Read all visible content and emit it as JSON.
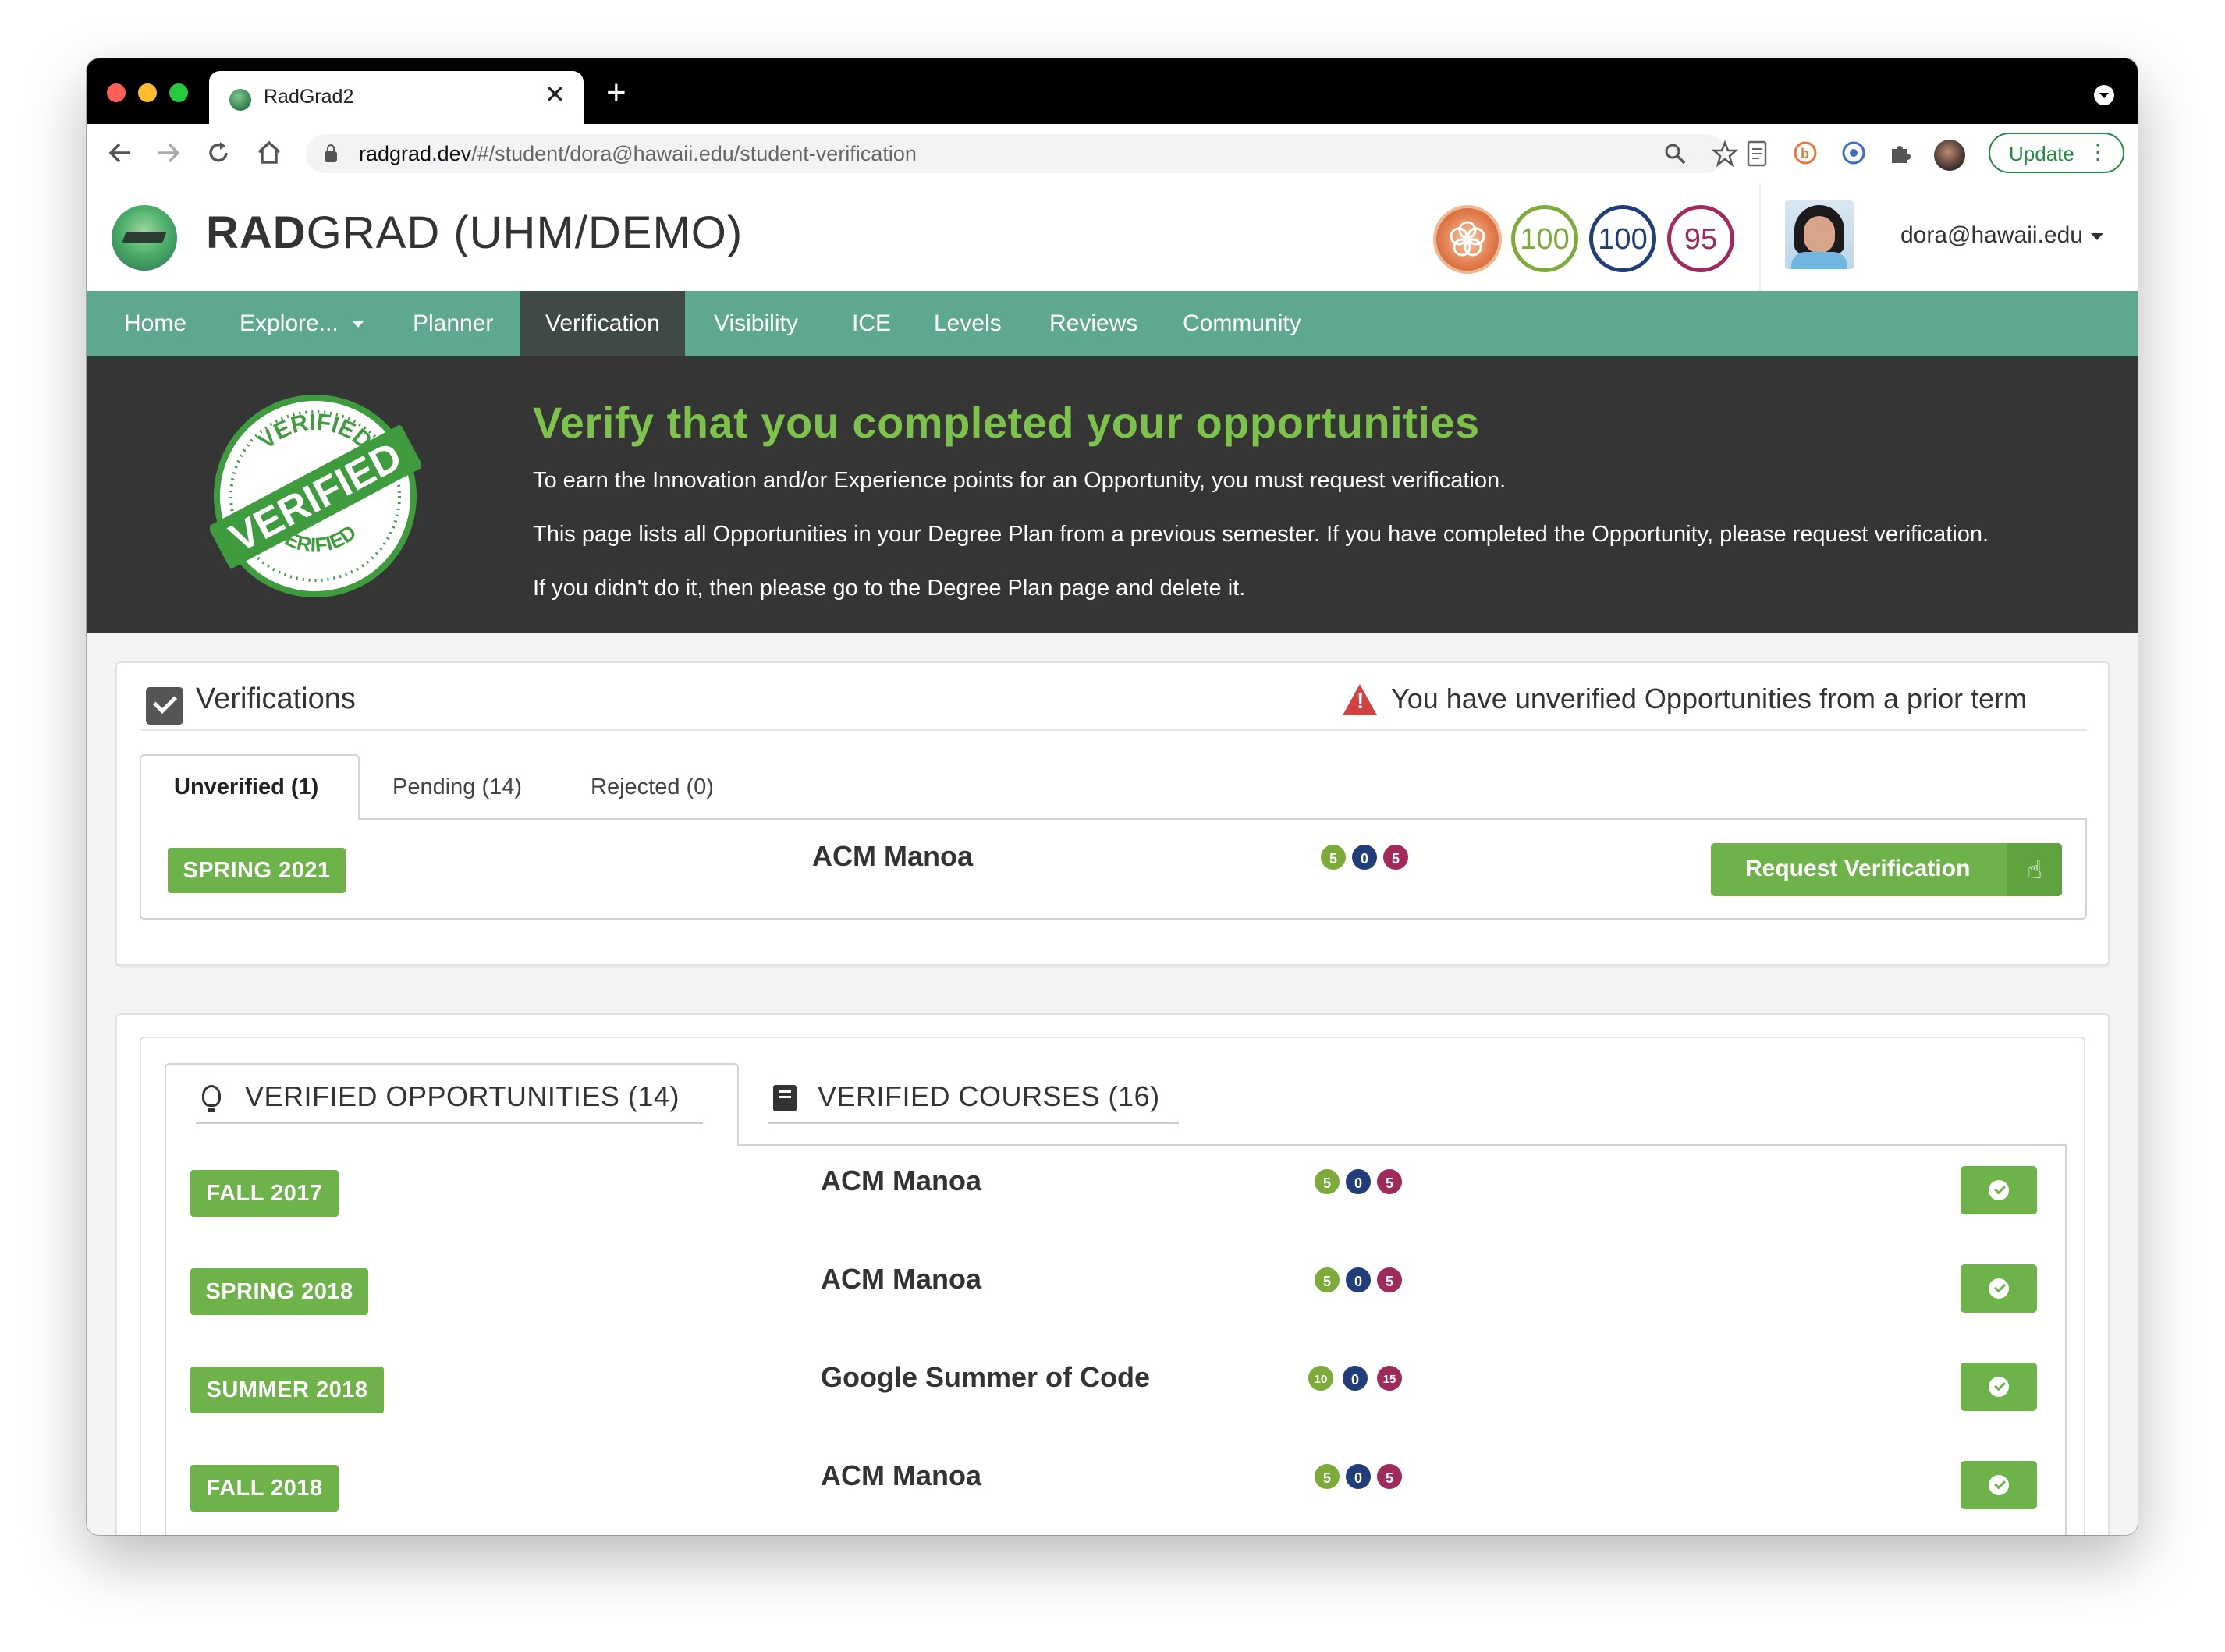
{
  "browser": {
    "tab_title": "RadGrad2",
    "close_glyph": "✕",
    "new_tab_glyph": "+",
    "url_host": "radgrad.dev",
    "url_path": "/#/student/dora@hawaii.edu/student-verification",
    "update_label": "Update",
    "nav_icons": [
      "back-arrow-icon",
      "forward-arrow-icon",
      "reload-icon",
      "home-icon"
    ],
    "extension_icons": [
      "reader-icon",
      "extension-b-icon",
      "extension-c-icon",
      "puzzle-icon",
      "profile-icon"
    ]
  },
  "header": {
    "brand_bold": "RAD",
    "brand_rest": "GRAD (UHM/DEMO)",
    "scores": [
      {
        "value": "100",
        "color": "#7cab3a"
      },
      {
        "value": "100",
        "color": "#213e7a"
      },
      {
        "value": "95",
        "color": "#a02a5a"
      }
    ],
    "user_email": "dora@hawaii.edu"
  },
  "nav": {
    "items": [
      "Home",
      "Explore...",
      "Planner",
      "Verification",
      "Visibility",
      "ICE",
      "Levels",
      "Reviews",
      "Community"
    ],
    "active": "Verification"
  },
  "hero": {
    "title": "Verify that you completed your opportunities",
    "p1": "To earn the Innovation and/or Experience points for an Opportunity, you must request verification.",
    "p2": "This page lists all Opportunities in your Degree Plan from a previous semester. If you have completed the Opportunity, please request verification.",
    "p3": "If you didn't do it, then please go to the Degree Plan page and delete it.",
    "stamp_text_top": "VERIFIED",
    "stamp_text_main": "VERIFIED",
    "stamp_text_bottom": "VERIFIED"
  },
  "verifications": {
    "title": "Verifications",
    "warning": "You have unverified Opportunities from a prior term",
    "tabs": [
      "Unverified (1)",
      "Pending (14)",
      "Rejected (0)"
    ],
    "unverified": [
      {
        "term": "SPRING 2021",
        "name": "ACM Manoa",
        "ice": [
          "5",
          "0",
          "5"
        ]
      }
    ],
    "request_label": "Request Verification"
  },
  "verified": {
    "tabs": [
      "VERIFIED OPPORTUNITIES (14)",
      "VERIFIED COURSES (16)"
    ],
    "rows": [
      {
        "term": "FALL 2017",
        "name": "ACM Manoa",
        "ice": [
          "5",
          "0",
          "5"
        ]
      },
      {
        "term": "SPRING 2018",
        "name": "ACM Manoa",
        "ice": [
          "5",
          "0",
          "5"
        ]
      },
      {
        "term": "SUMMER 2018",
        "name": "Google Summer of Code",
        "ice": [
          "10",
          "0",
          "15"
        ]
      },
      {
        "term": "FALL 2018",
        "name": "ACM Manoa",
        "ice": [
          "5",
          "0",
          "5"
        ]
      }
    ]
  },
  "colors": {
    "nav_green": "#5ea98e",
    "accent_green": "#6db34a",
    "hero_bg": "#353535",
    "innovation": "#7cab3a",
    "competency": "#213e7a",
    "experience": "#a02a5a"
  }
}
